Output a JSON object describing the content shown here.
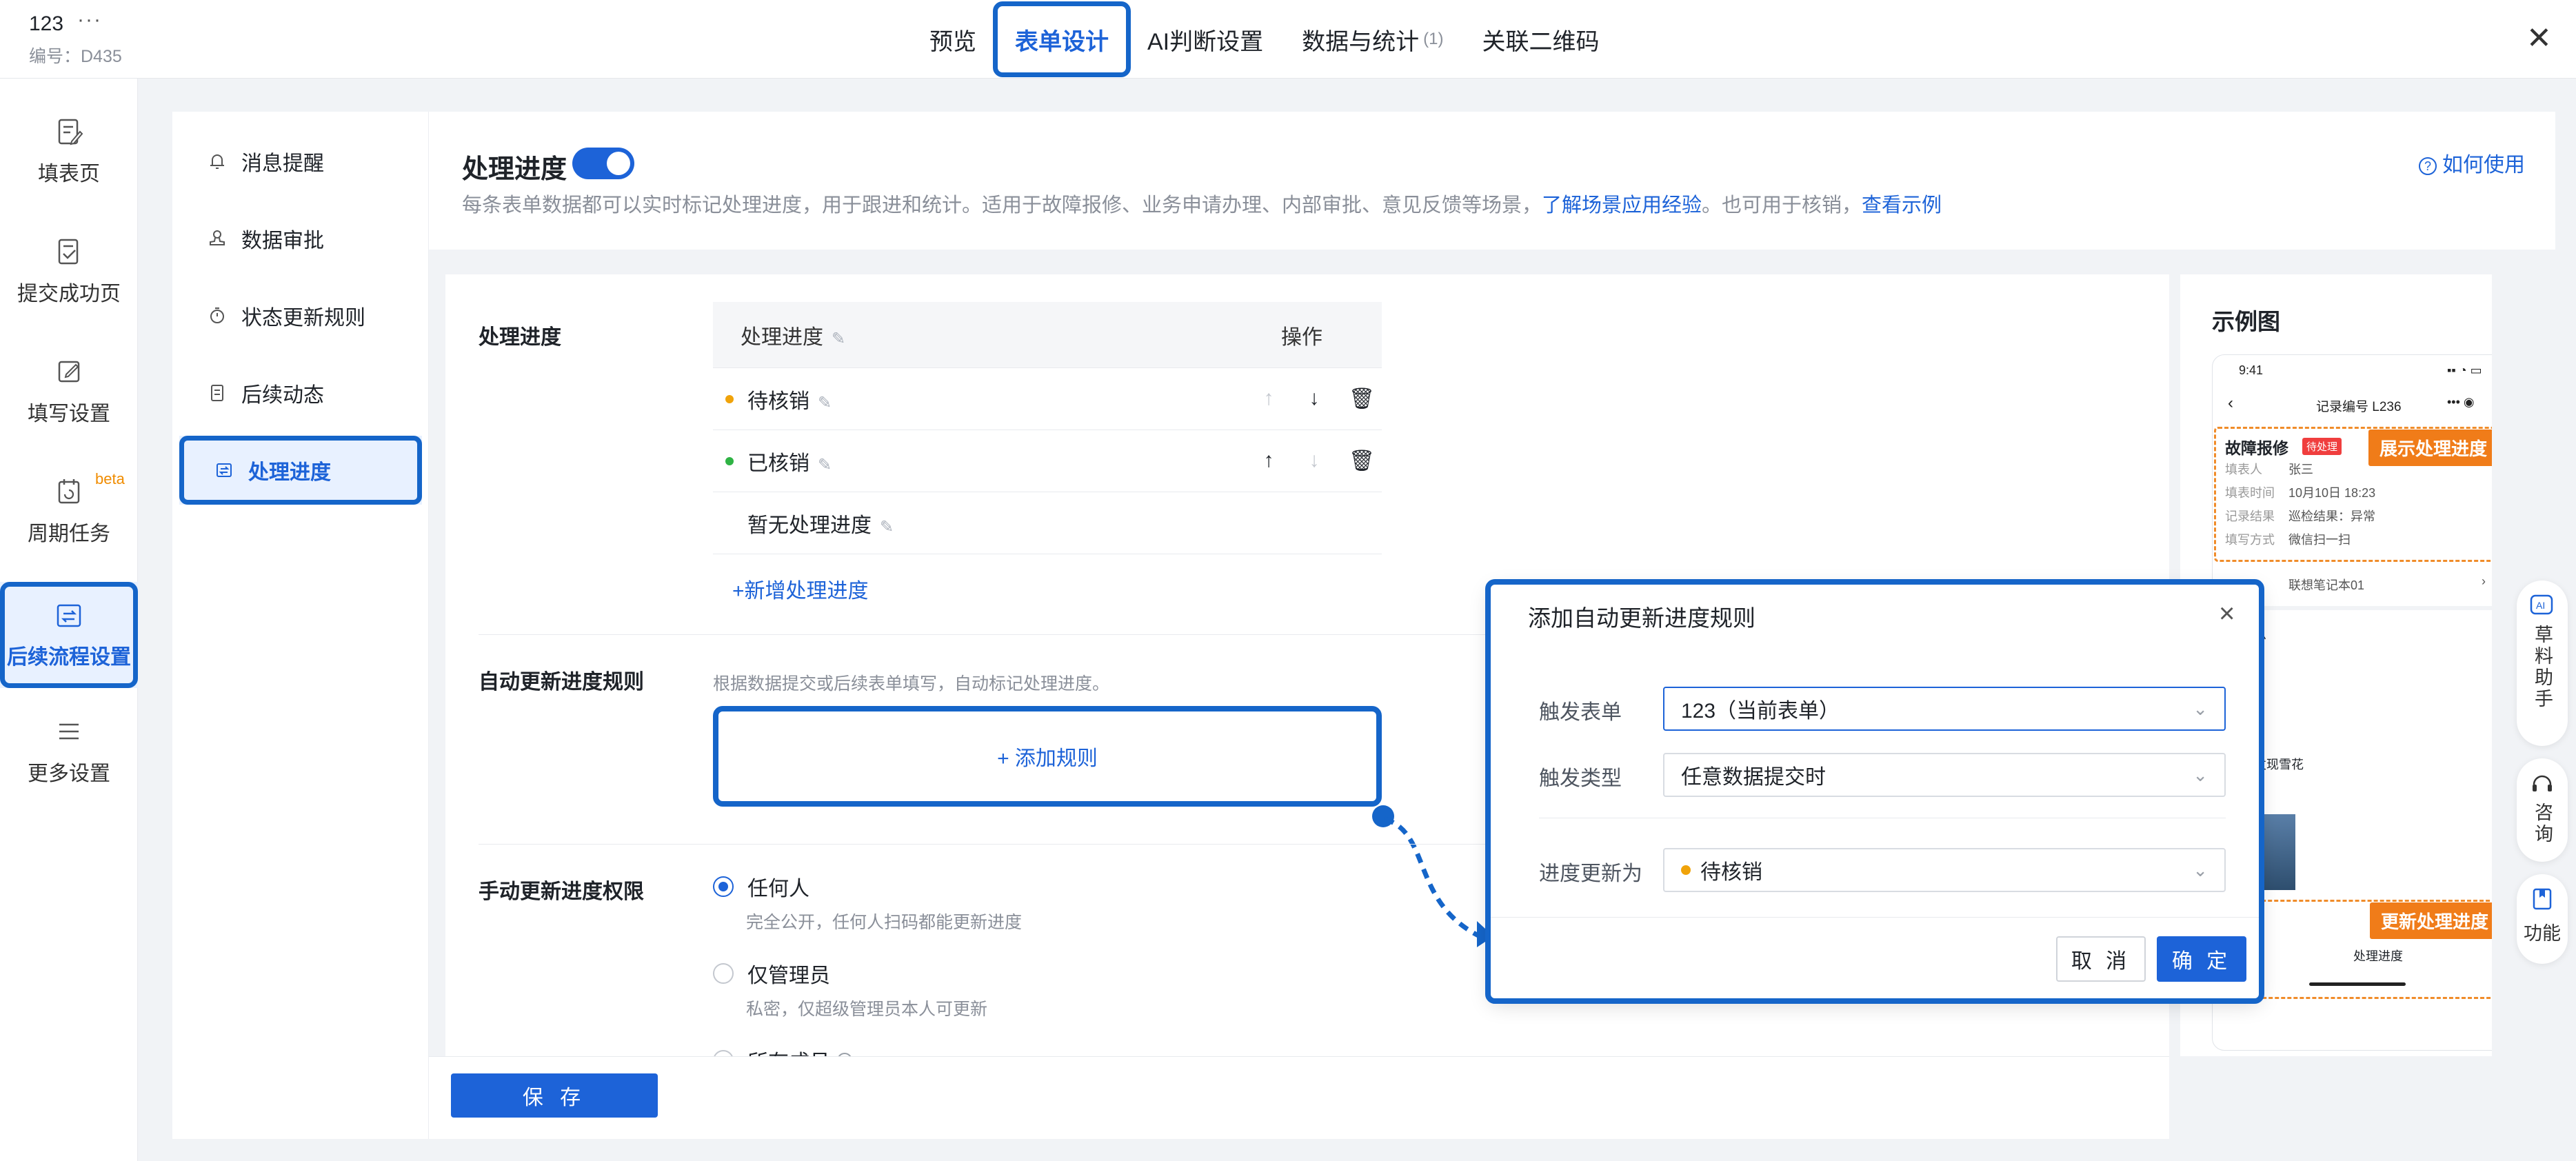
{
  "header": {
    "form_name": "123",
    "more": "···",
    "form_code": "编号：D435",
    "tabs": [
      {
        "label": "预览"
      },
      {
        "label": "表单设计"
      },
      {
        "label": "AI判断设置"
      },
      {
        "label": "数据与统计",
        "count": "(1)"
      },
      {
        "label": "关联二维码"
      }
    ],
    "close": "✕"
  },
  "rail": {
    "items": [
      {
        "label": "填表页"
      },
      {
        "label": "提交成功页"
      },
      {
        "label": "填写设置"
      },
      {
        "label": "周期任务",
        "badge": "beta"
      },
      {
        "label": "后续流程设置"
      },
      {
        "label": "更多设置"
      }
    ]
  },
  "subnav": {
    "items": [
      {
        "label": "消息提醒"
      },
      {
        "label": "数据审批"
      },
      {
        "label": "状态更新规则"
      },
      {
        "label": "后续动态"
      },
      {
        "label": "处理进度"
      }
    ]
  },
  "page": {
    "title": "处理进度",
    "desc_prefix": "每条表单数据都可以实时标记处理进度，用于跟进和统计。适用于故障报修、业务申请办理、内部审批、意见反馈等场景，",
    "desc_link1": "了解场景应用经验",
    "desc_mid": "。也可用于核销，",
    "desc_link2": "查看示例",
    "howto": "如何使用"
  },
  "progress": {
    "section_label": "处理进度",
    "col_name": "处理进度",
    "col_ops": "操作",
    "rows": [
      {
        "name": "待核销",
        "color": "#f0a30a"
      },
      {
        "name": "已核销",
        "color": "#2fb344"
      },
      {
        "name": "暂无处理进度"
      }
    ],
    "add_label": "+新增处理进度"
  },
  "auto_rule": {
    "section_label": "自动更新进度规则",
    "hint": "根据数据提交或后续表单填写，自动标记处理进度。",
    "add_label": "+ 添加规则"
  },
  "manual": {
    "section_label": "手动更新进度权限",
    "options": [
      {
        "label": "任何人",
        "desc": "完全公开，任何人扫码都能更新进度"
      },
      {
        "label": "仅管理员",
        "desc": "私密，仅超级管理员本人可更新"
      },
      {
        "label": "所有成员"
      }
    ]
  },
  "footer": {
    "save": "保 存"
  },
  "example": {
    "title": "示例图",
    "status_time": "9:41",
    "nav_title": "记录编号 L236",
    "card_title": "故障报修",
    "card_tag": "待处理",
    "show_tag": "展示处理进度",
    "rows": [
      {
        "k": "填表人",
        "v": "张三"
      },
      {
        "k": "填表时间",
        "v": "10月10日 18:23"
      },
      {
        "k": "记录结果",
        "v": "巡检结果：异常"
      },
      {
        "k": "填写方式",
        "v": "微信扫一扫"
      }
    ],
    "linked": "联想笔记本01",
    "section2": "息",
    "person": "发现雪花",
    "update_tag": "更新处理进度",
    "bottom_action": "处理进度"
  },
  "dialog": {
    "title": "添加自动更新进度规则",
    "trigger_form_label": "触发表单",
    "trigger_form_value": "123（当前表单）",
    "trigger_type_label": "触发类型",
    "trigger_type_value": "任意数据提交时",
    "update_to_label": "进度更新为",
    "update_to_value": "待核销",
    "cancel": "取 消",
    "ok": "确 定"
  },
  "floating": {
    "assistant": "草料助手",
    "consult": "咨询",
    "feature": "功能"
  }
}
